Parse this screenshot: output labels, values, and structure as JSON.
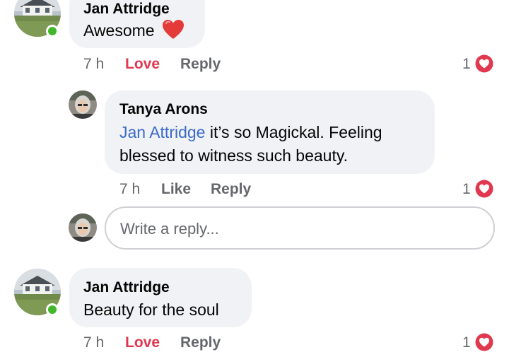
{
  "comments": [
    {
      "author": "Jan Attridge",
      "text": "Awesome",
      "emoji": "❤️",
      "time": "7 h",
      "reaction_action": "Love",
      "reply_action": "Reply",
      "reaction_count": "1",
      "online": true
    },
    {
      "author": "Tanya Arons",
      "mention": "Jan Attridge",
      "text_line1": " it’s so Magickal.  Feeling",
      "text_line2": "blessed to witness such beauty.",
      "time": "7 h",
      "reaction_action": "Like",
      "reply_action": "Reply",
      "reaction_count": "1"
    },
    {
      "author": "Jan Attridge",
      "text": "Beauty for the soul",
      "time": "7 h",
      "reaction_action": "Love",
      "reply_action": "Reply",
      "reaction_count": "1",
      "online": true
    }
  ],
  "reply_box": {
    "placeholder": "Write a reply..."
  },
  "colors": {
    "love": "#e0384f",
    "mention": "#3b6bc9",
    "bubble": "#f0f2f5",
    "online": "#42b72a",
    "meta": "#65676b"
  },
  "icons": {
    "reaction": "heart-reaction-icon",
    "online": "online-status-icon"
  }
}
